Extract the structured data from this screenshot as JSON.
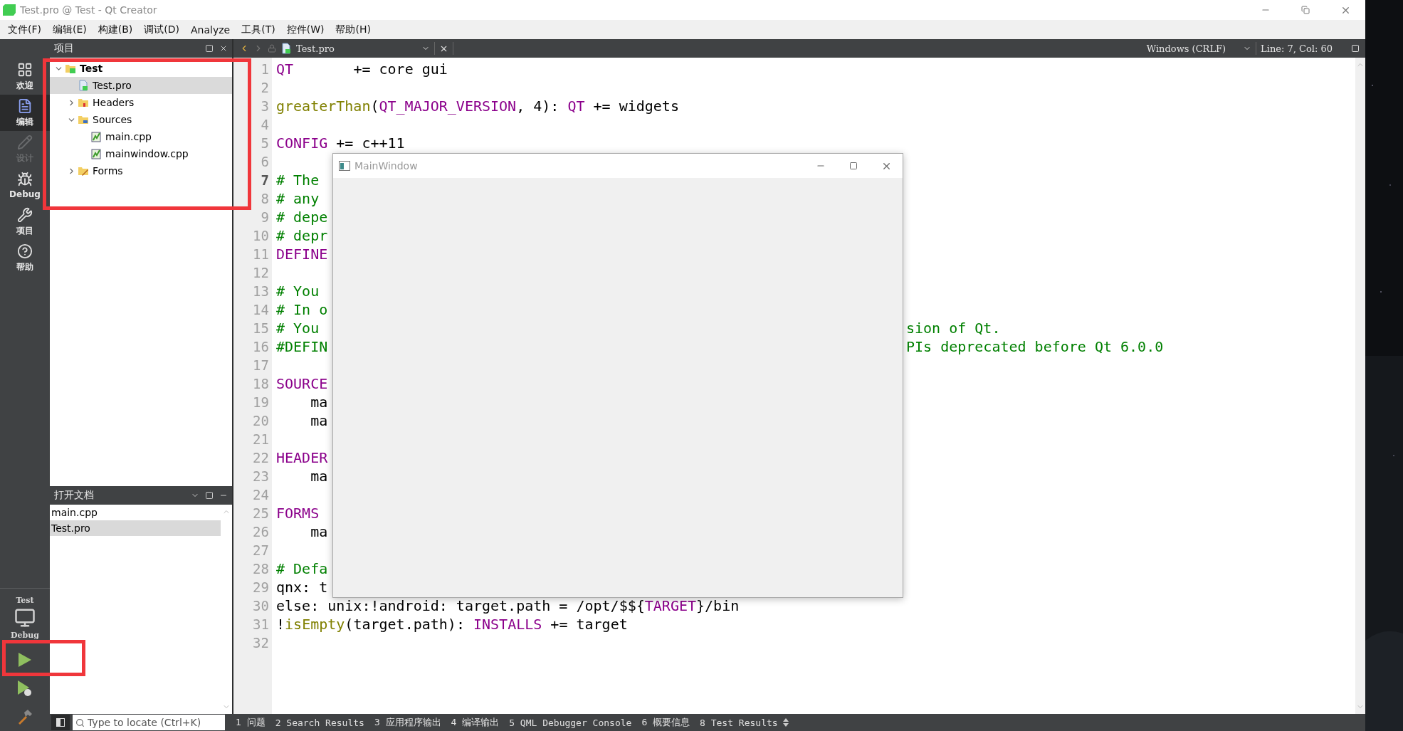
{
  "window": {
    "title": "Test.pro @ Test - Qt Creator"
  },
  "menu": [
    "文件(F)",
    "编辑(E)",
    "构建(B)",
    "调试(D)",
    "Analyze",
    "工具(T)",
    "控件(W)",
    "帮助(H)"
  ],
  "modes": [
    {
      "label": "欢迎",
      "kind": "grid",
      "selected": false,
      "disabled": false
    },
    {
      "label": "编辑",
      "kind": "document",
      "selected": true,
      "disabled": false
    },
    {
      "label": "设计",
      "kind": "pencil",
      "selected": false,
      "disabled": true
    },
    {
      "label": "Debug",
      "kind": "bug",
      "selected": false,
      "disabled": false
    },
    {
      "label": "项目",
      "kind": "wrench",
      "selected": false,
      "disabled": false
    },
    {
      "label": "帮助",
      "kind": "help",
      "selected": false,
      "disabled": false
    }
  ],
  "target": {
    "project": "Test",
    "build": "Debug"
  },
  "project_panel": {
    "title": "项目",
    "tree": [
      {
        "label": "Test",
        "kind": "project",
        "expanded": true,
        "selected": false,
        "children": [
          {
            "label": "Test.pro",
            "kind": "pro",
            "selected": true
          },
          {
            "label": "Headers",
            "kind": "headers",
            "expanded": false,
            "selected": false
          },
          {
            "label": "Sources",
            "kind": "sources",
            "expanded": true,
            "selected": false,
            "children": [
              {
                "label": "main.cpp",
                "kind": "cpp",
                "selected": false
              },
              {
                "label": "mainwindow.cpp",
                "kind": "cpp",
                "selected": false
              }
            ]
          },
          {
            "label": "Forms",
            "kind": "forms",
            "expanded": false,
            "selected": false
          }
        ]
      }
    ]
  },
  "open_documents": {
    "title": "打开文档",
    "items": [
      {
        "label": "main.cpp",
        "selected": false
      },
      {
        "label": "Test.pro",
        "selected": true
      }
    ]
  },
  "editor": {
    "file_tab": "Test.pro",
    "line_ending": "Windows (CRLF)",
    "cursor": "Line: 7, Col: 60",
    "lines": [
      {
        "number": "1",
        "current": false,
        "segments": [
          {
            "kind": "keyword",
            "text": "QT"
          },
          {
            "kind": "plain",
            "text": "       += core gui"
          }
        ]
      },
      {
        "number": "2",
        "current": false
      },
      {
        "number": "3",
        "current": false,
        "segments": [
          {
            "kind": "function",
            "text": "greaterThan"
          },
          {
            "kind": "plain",
            "text": "("
          },
          {
            "kind": "keyword",
            "text": "QT_MAJOR_VERSION"
          },
          {
            "kind": "plain",
            "text": ", 4): "
          },
          {
            "kind": "keyword",
            "text": "QT"
          },
          {
            "kind": "plain",
            "text": " += widgets"
          }
        ]
      },
      {
        "number": "4",
        "current": false
      },
      {
        "number": "5",
        "current": false,
        "segments": [
          {
            "kind": "keyword",
            "text": "CONFIG"
          },
          {
            "kind": "plain",
            "text": " += c++11"
          }
        ]
      },
      {
        "number": "6",
        "current": false
      },
      {
        "number": "7",
        "current": true,
        "covered": true,
        "segments": [
          {
            "kind": "comment",
            "text": "# The"
          }
        ]
      },
      {
        "number": "8",
        "current": false,
        "covered": true,
        "segments": [
          {
            "kind": "comment",
            "text": "# any"
          }
        ]
      },
      {
        "number": "9",
        "current": false,
        "covered": true,
        "segments": [
          {
            "kind": "comment",
            "text": "# depe"
          }
        ]
      },
      {
        "number": "10",
        "current": false,
        "covered": true,
        "segments": [
          {
            "kind": "comment",
            "text": "# depr"
          }
        ]
      },
      {
        "number": "11",
        "current": false,
        "covered": true,
        "segments": [
          {
            "kind": "keyword",
            "text": "DEFINE"
          }
        ]
      },
      {
        "number": "12",
        "current": false,
        "covered": true
      },
      {
        "number": "13",
        "current": false,
        "covered": true,
        "segments": [
          {
            "kind": "comment",
            "text": "# You"
          }
        ]
      },
      {
        "number": "14",
        "current": false,
        "covered": true,
        "segments": [
          {
            "kind": "comment",
            "text": "# In o"
          }
        ]
      },
      {
        "number": "15",
        "current": false,
        "covered": true,
        "segments": [
          {
            "kind": "comment",
            "text": "# You"
          }
        ],
        "tail": [
          {
            "kind": "comment",
            "text": "sion of Qt."
          }
        ]
      },
      {
        "number": "16",
        "current": false,
        "covered": true,
        "segments": [
          {
            "kind": "comment",
            "text": "#DEFIN"
          }
        ],
        "tail": [
          {
            "kind": "comment",
            "text": "PIs deprecated before Qt 6.0.0"
          }
        ]
      },
      {
        "number": "17",
        "current": false,
        "covered": true
      },
      {
        "number": "18",
        "current": false,
        "covered": true,
        "segments": [
          {
            "kind": "keyword",
            "text": "SOURCE"
          }
        ]
      },
      {
        "number": "19",
        "current": false,
        "covered": true,
        "segments": [
          {
            "kind": "plain",
            "text": "    ma"
          }
        ]
      },
      {
        "number": "20",
        "current": false,
        "covered": true,
        "segments": [
          {
            "kind": "plain",
            "text": "    ma"
          }
        ]
      },
      {
        "number": "21",
        "current": false,
        "covered": true
      },
      {
        "number": "22",
        "current": false,
        "covered": true,
        "segments": [
          {
            "kind": "keyword",
            "text": "HEADER"
          }
        ]
      },
      {
        "number": "23",
        "current": false,
        "covered": true,
        "segments": [
          {
            "kind": "plain",
            "text": "    ma"
          }
        ]
      },
      {
        "number": "24",
        "current": false,
        "covered": true
      },
      {
        "number": "25",
        "current": false,
        "covered": true,
        "segments": [
          {
            "kind": "keyword",
            "text": "FORMS"
          }
        ]
      },
      {
        "number": "26",
        "current": false,
        "covered": true,
        "segments": [
          {
            "kind": "plain",
            "text": "    ma"
          }
        ]
      },
      {
        "number": "27",
        "current": false,
        "covered": true
      },
      {
        "number": "28",
        "current": false,
        "covered": true,
        "segments": [
          {
            "kind": "comment",
            "text": "# Defa"
          }
        ]
      },
      {
        "number": "29",
        "current": false,
        "covered": true,
        "segments": [
          {
            "kind": "plain",
            "text": "qnx: t"
          }
        ]
      },
      {
        "number": "30",
        "current": false,
        "segments": [
          {
            "kind": "plain",
            "text": "else: unix:!android: target.path = /opt/$${"
          },
          {
            "kind": "keyword",
            "text": "TARGET"
          },
          {
            "kind": "plain",
            "text": "}/bin"
          }
        ]
      },
      {
        "number": "31",
        "current": false,
        "segments": [
          {
            "kind": "plain",
            "text": "!"
          },
          {
            "kind": "function",
            "text": "isEmpty"
          },
          {
            "kind": "plain",
            "text": "(target.path): "
          },
          {
            "kind": "keyword",
            "text": "INSTALLS"
          },
          {
            "kind": "plain",
            "text": " += target"
          }
        ]
      },
      {
        "number": "32",
        "current": false
      }
    ]
  },
  "popup": {
    "title": "MainWindow"
  },
  "status_bar": {
    "locator_placeholder": "Type to locate (Ctrl+K)",
    "tabs": [
      "1 问题",
      "2 Search Results",
      "3 应用程序输出",
      "4 编译输出",
      "5 QML Debugger Console",
      "6 概要信息",
      "8 Test Results"
    ]
  }
}
